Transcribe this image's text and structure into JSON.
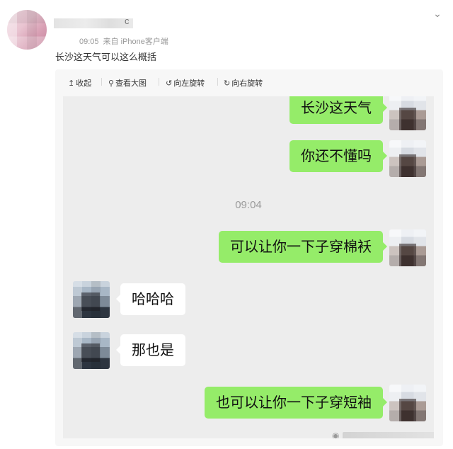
{
  "post": {
    "username_tail": "c",
    "time": "09:05",
    "source": "来自 iPhone客户端",
    "text": "长沙这天气可以这么概括"
  },
  "toolbar": {
    "collapse": "收起",
    "view_large": "查看大图",
    "rotate_left": "向左旋转",
    "rotate_right": "向右旋转"
  },
  "chat": {
    "messages": [
      {
        "side": "right",
        "text": "长沙这天气"
      },
      {
        "side": "right",
        "text": "你还不懂吗"
      },
      {
        "side": "right",
        "text": "可以让你一下子穿棉袄"
      },
      {
        "side": "left",
        "text": "哈哈哈"
      },
      {
        "side": "left",
        "text": "那也是"
      },
      {
        "side": "right",
        "text": "也可以让你一下子穿短袖"
      }
    ],
    "timestamp": "09:04"
  },
  "icons": {
    "collapse": "arrow-up-icon",
    "view_large": "magnifier-icon",
    "rotate_left": "rotate-left-icon",
    "rotate_right": "rotate-right-icon",
    "menu": "chevron-down-icon"
  },
  "colors": {
    "bubble_self": "#95ec69",
    "bubble_other": "#ffffff",
    "chat_bg": "#ededed"
  }
}
